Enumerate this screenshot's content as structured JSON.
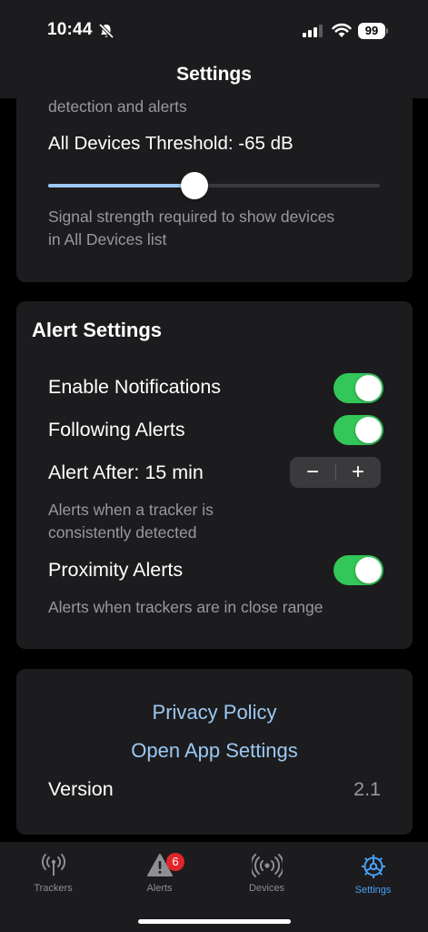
{
  "status_bar": {
    "time": "10:44",
    "battery": "99"
  },
  "nav": {
    "title": "Settings"
  },
  "detection_card": {
    "cut_text": "detection and alerts",
    "threshold_label": "All Devices Threshold: -65 dB",
    "threshold_fraction": 0.44,
    "threshold_help": [
      "Signal strength required to show devices",
      "in All Devices list"
    ]
  },
  "alert_settings": {
    "title": "Alert Settings",
    "enable_notifications": {
      "label": "Enable Notifications",
      "on": true
    },
    "following_alerts": {
      "label": "Following Alerts",
      "on": true
    },
    "alert_after": {
      "label": "Alert After: 15 min",
      "minus": "−",
      "plus": "+"
    },
    "alert_after_help": [
      "Alerts when a tracker is",
      "consistently detected"
    ],
    "proximity_alerts": {
      "label": "Proximity Alerts",
      "on": true
    },
    "proximity_help": "Alerts when trackers are in close range"
  },
  "info_card": {
    "privacy_policy": "Privacy Policy",
    "open_app_settings": "Open App Settings",
    "version_label": "Version",
    "version_value": "2.1"
  },
  "tabbar": {
    "tabs": [
      {
        "label": "Trackers",
        "icon": "antenna-icon"
      },
      {
        "label": "Alerts",
        "icon": "warning-icon",
        "badge": "6"
      },
      {
        "label": "Devices",
        "icon": "broadcast-icon"
      },
      {
        "label": "Settings",
        "icon": "gear-icon",
        "active": true
      }
    ]
  },
  "colors": {
    "accent": "#4a9ff5",
    "toggle_on": "#33c759",
    "link": "#9cc8f3",
    "badge": "#e0262a"
  }
}
